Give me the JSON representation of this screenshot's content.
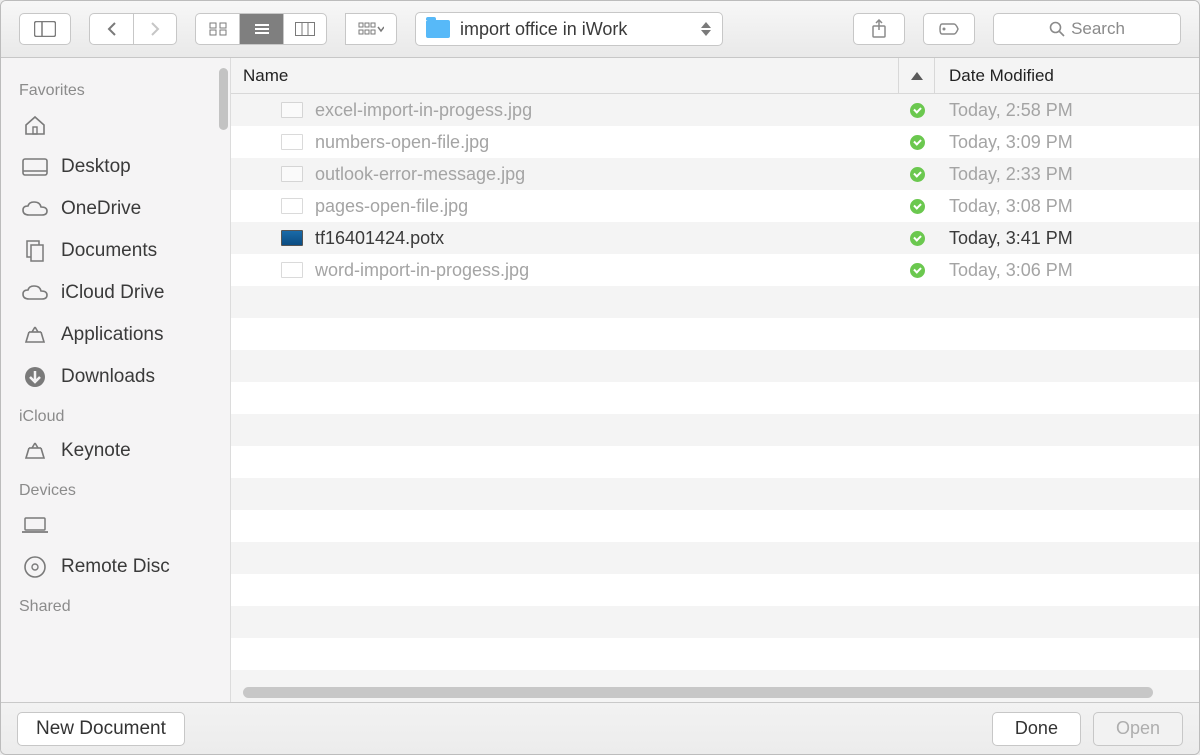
{
  "toolbar": {
    "folder_title": "import office in iWork",
    "search_placeholder": "Search"
  },
  "columns": {
    "name": "Name",
    "date_modified": "Date Modified"
  },
  "sidebar": {
    "sections": [
      {
        "heading": "Favorites",
        "items": [
          {
            "icon": "home",
            "label": ""
          },
          {
            "icon": "desktop",
            "label": "Desktop"
          },
          {
            "icon": "cloud",
            "label": "OneDrive"
          },
          {
            "icon": "documents",
            "label": "Documents"
          },
          {
            "icon": "cloud",
            "label": "iCloud Drive"
          },
          {
            "icon": "apps",
            "label": "Applications"
          },
          {
            "icon": "download",
            "label": "Downloads"
          }
        ]
      },
      {
        "heading": "iCloud",
        "items": [
          {
            "icon": "apps",
            "label": "Keynote"
          }
        ]
      },
      {
        "heading": "Devices",
        "items": [
          {
            "icon": "laptop",
            "label": ""
          },
          {
            "icon": "disc",
            "label": "Remote Disc"
          }
        ]
      },
      {
        "heading": "Shared",
        "items": []
      }
    ]
  },
  "files": [
    {
      "name": "excel-import-in-progess.jpg",
      "date": "Today, 2:58 PM",
      "synced": true,
      "dimmed": true,
      "kind": "jpg"
    },
    {
      "name": "numbers-open-file.jpg",
      "date": "Today, 3:09 PM",
      "synced": true,
      "dimmed": true,
      "kind": "jpg"
    },
    {
      "name": "outlook-error-message.jpg",
      "date": "Today, 2:33 PM",
      "synced": true,
      "dimmed": true,
      "kind": "jpg"
    },
    {
      "name": "pages-open-file.jpg",
      "date": "Today, 3:08 PM",
      "synced": true,
      "dimmed": true,
      "kind": "jpg"
    },
    {
      "name": "tf16401424.potx",
      "date": "Today, 3:41 PM",
      "synced": true,
      "dimmed": false,
      "kind": "potx"
    },
    {
      "name": "word-import-in-progess.jpg",
      "date": "Today, 3:06 PM",
      "synced": true,
      "dimmed": true,
      "kind": "jpg"
    }
  ],
  "footer": {
    "new_document": "New Document",
    "done": "Done",
    "open": "Open"
  }
}
